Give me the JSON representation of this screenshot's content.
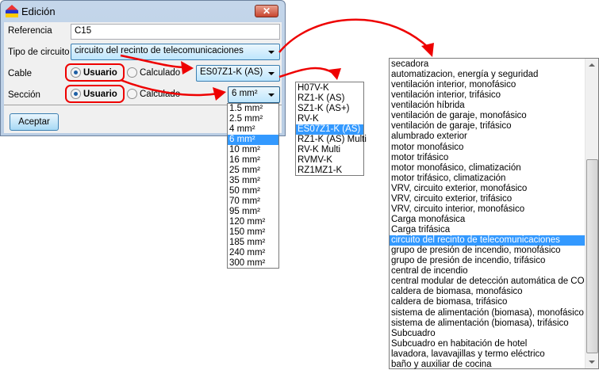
{
  "window": {
    "title": "Edición",
    "close": "✕"
  },
  "form": {
    "referencia_label": "Referencia",
    "referencia_value": "C15",
    "tipo_label": "Tipo de circuito",
    "tipo_value": "circuito del recinto de telecomunicaciones",
    "cable_label": "Cable",
    "cable_usuario": "Usuario",
    "cable_calculado": "Calculado",
    "cable_value": "ES07Z1-K (AS)",
    "seccion_label": "Sección",
    "seccion_usuario": "Usuario",
    "seccion_calculado": "Calculado",
    "seccion_value": "6 mm²",
    "accept": "Aceptar"
  },
  "seccion_options": [
    "1.5 mm²",
    "2.5 mm²",
    "4 mm²",
    "6 mm²",
    "10 mm²",
    "16 mm²",
    "25 mm²",
    "35 mm²",
    "50 mm²",
    "70 mm²",
    "95 mm²",
    "120 mm²",
    "150 mm²",
    "185 mm²",
    "240 mm²",
    "300 mm²"
  ],
  "seccion_selected": 3,
  "cable_options": [
    "H07V-K",
    "RZ1-K (AS)",
    "SZ1-K (AS+)",
    "RV-K",
    "ES07Z1-K (AS)",
    "RZ1-K (AS) Multi",
    "RV-K Multi",
    "RVMV-K",
    "RZ1MZ1-K"
  ],
  "cable_selected": 4,
  "tipo_options": [
    "secadora",
    "automatizacion, energía y seguridad",
    "ventilación interior, monofásico",
    "ventilación interior, trifásico",
    "ventilación híbrida",
    "ventilación de garaje, monofásico",
    "ventilación de garaje, trifásico",
    "alumbrado exterior",
    "motor monofásico",
    "motor trifásico",
    "motor monofásico, climatización",
    "motor trifásico, climatización",
    "VRV, circuito exterior, monofásico",
    "VRV, circuito exterior, trifásico",
    "VRV, circuito interior, monofásico",
    "Carga monofásica",
    "Carga trifásica",
    "circuito del recinto de telecomunicaciones",
    "grupo de presión de incendio, monofásico",
    "grupo de presión de incendio, trifásico",
    "central de incendio",
    "central modular de detección automática de CO",
    "caldera de biomasa, monofásico",
    "caldera de biomasa, trifásico",
    "sistema de alimentación (biomasa), monofásico",
    "sistema de alimentación (biomasa), trifásico",
    "Subcuadro",
    "Subcuadro en habitación de hotel",
    "lavadora, lavavajillas y termo eléctrico",
    "baño y auxiliar de cocina"
  ],
  "tipo_selected": 17,
  "colors": {
    "selection": "#3399ff",
    "annotation": "#ee0000"
  }
}
